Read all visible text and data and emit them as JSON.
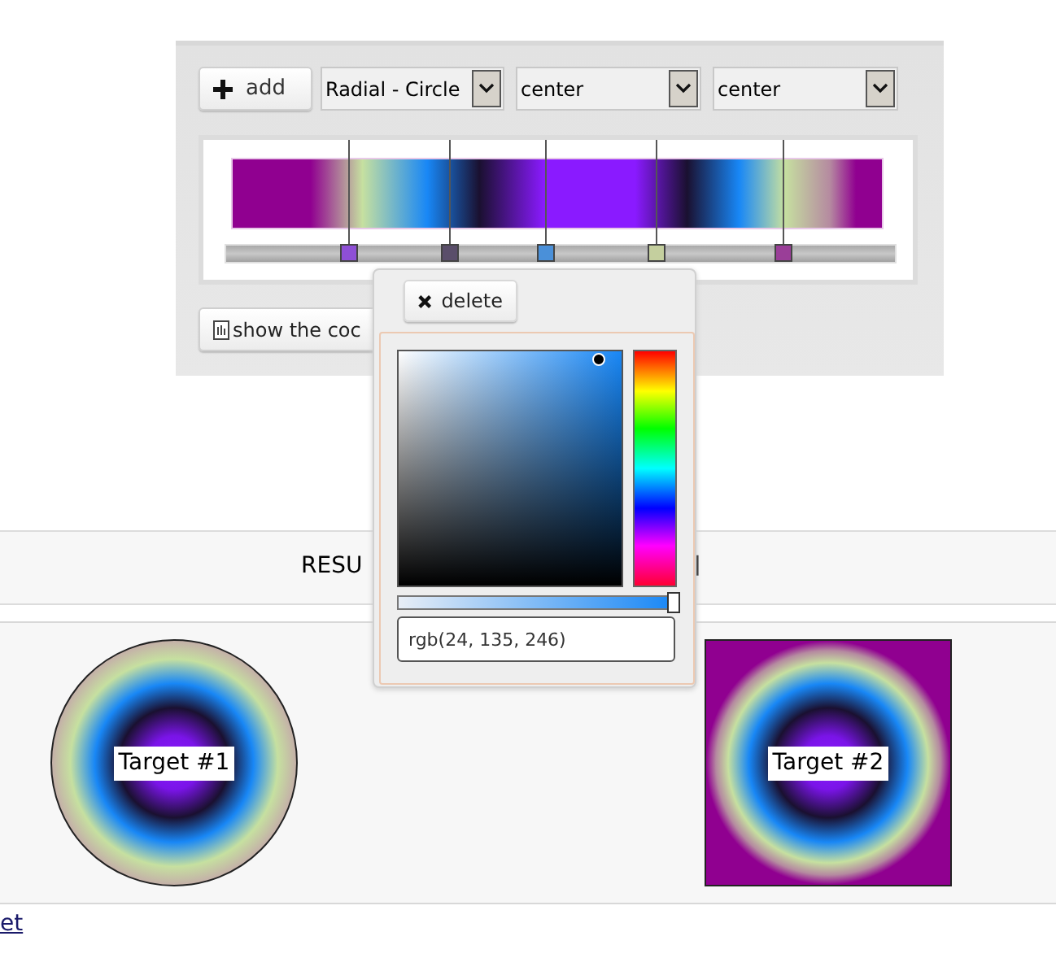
{
  "toolbar": {
    "add_button": "add",
    "selects": [
      {
        "value": "Radial - Circle"
      },
      {
        "value": "center"
      },
      {
        "value": "center"
      }
    ]
  },
  "stops": [
    {
      "color": "#8e4fd6",
      "level": 0.17
    },
    {
      "color": "#5a4e6a",
      "level": 0.32
    },
    {
      "color": "#4a90d9",
      "level": 0.465
    },
    {
      "color": "#c4cf9e",
      "level": 0.63
    },
    {
      "color": "#9a3e98",
      "level": 0.82
    }
  ],
  "show_code_button": "show the coc",
  "color_popup": {
    "delete_button": "delete",
    "alpha": {
      "level": 1
    },
    "value": "rgb(24, 135, 246)"
  },
  "results": {
    "header_left": "RESU",
    "header_right": "]",
    "targets": [
      {
        "label": "Target #1",
        "kind": "circle"
      },
      {
        "label": "Target #2",
        "kind": "square"
      }
    ]
  },
  "footer_link": "et"
}
